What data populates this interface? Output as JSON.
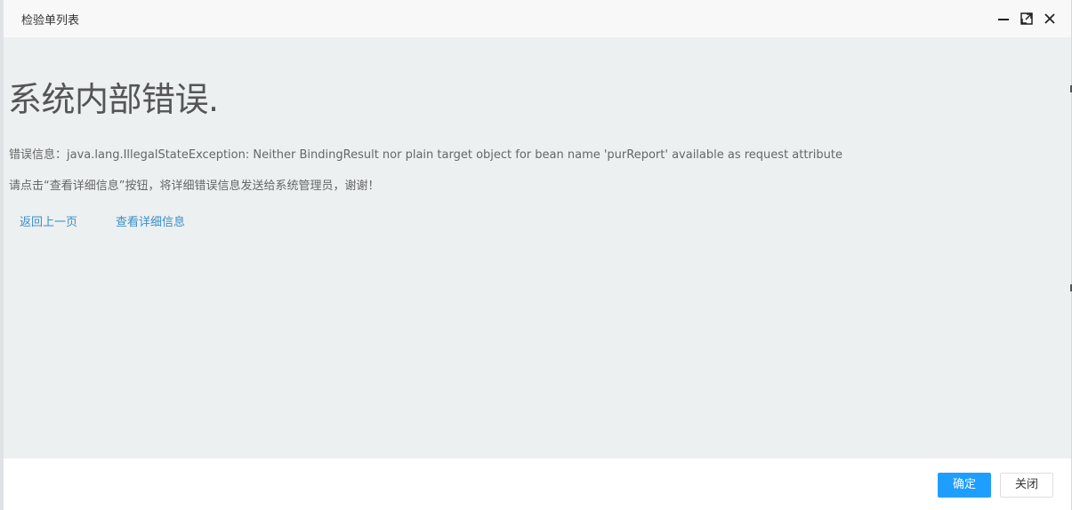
{
  "window": {
    "title": "检验单列表"
  },
  "error": {
    "heading": "系统内部错误.",
    "message": "错误信息：java.lang.IllegalStateException: Neither BindingResult nor plain target object for bean name 'purReport' available as request attribute",
    "hint": "请点击“查看详细信息”按钮，将详细错误信息发送给系统管理员，谢谢！"
  },
  "links": {
    "back": "返回上一页",
    "detail": "查看详细信息"
  },
  "footer": {
    "ok_label": "确定",
    "close_label": "关闭"
  },
  "colors": {
    "primary_button": "#1e9fff",
    "link": "#3a8ec9",
    "content_bg": "#ecf0f1"
  },
  "icons": {
    "minimize": "minimize-icon",
    "maximize": "maximize-icon",
    "close": "close-icon"
  }
}
